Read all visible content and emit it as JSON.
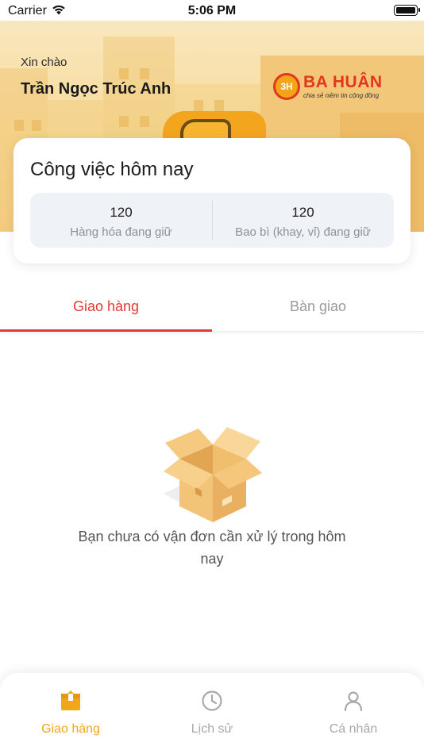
{
  "status_bar": {
    "carrier": "Carrier",
    "time": "5:06 PM"
  },
  "header": {
    "greeting": "Xin chào",
    "user_name": "Trần Ngọc Trúc Anh",
    "brand": {
      "badge": "3H",
      "name": "BA HUÂN",
      "tagline": "chia sẻ niềm tin cộng đồng"
    }
  },
  "summary": {
    "title": "Công việc hôm nay",
    "stats": [
      {
        "value": "120",
        "label": "Hàng hóa đang giữ"
      },
      {
        "value": "120",
        "label": "Bao bì (khay, vỉ) đang giữ"
      }
    ]
  },
  "tabs": [
    {
      "label": "Giao hàng",
      "active": true
    },
    {
      "label": "Bàn giao",
      "active": false
    }
  ],
  "empty_state": {
    "message": "Bạn chưa có vận đơn cần xử lý trong hôm nay",
    "icon": "open-box-icon"
  },
  "bottom_nav": [
    {
      "label": "Giao hàng",
      "icon": "delivery-box-icon",
      "active": true
    },
    {
      "label": "Lịch sử",
      "icon": "clock-icon",
      "active": false
    },
    {
      "label": "Cá nhân",
      "icon": "person-icon",
      "active": false
    }
  ],
  "colors": {
    "accent": "#e53935",
    "nav_active": "#f2a71b",
    "banner": "#f7dda0"
  }
}
